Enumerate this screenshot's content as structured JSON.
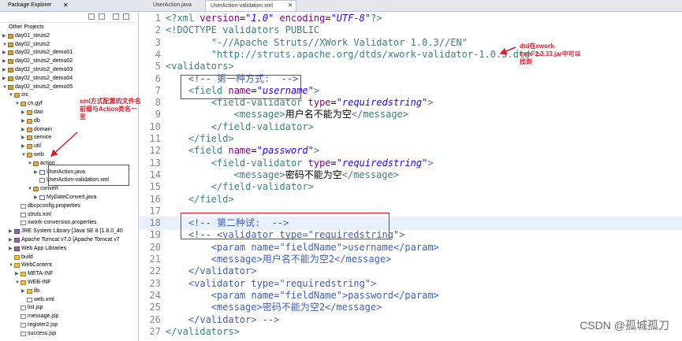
{
  "explorer": {
    "title": "Package Explorer",
    "close": "✕",
    "tree": [
      {
        "label": "Other Projects",
        "depth": 0,
        "icon": "none",
        "twisty": ""
      },
      {
        "label": "day01_struts2",
        "depth": 0,
        "icon": "proj",
        "twisty": "▶"
      },
      {
        "label": "day02_struts2",
        "depth": 0,
        "icon": "proj",
        "twisty": "▼"
      },
      {
        "label": "day02_struts2_demo01",
        "depth": 0,
        "icon": "proj",
        "twisty": "▶"
      },
      {
        "label": "day02_struts2_demo02",
        "depth": 0,
        "icon": "proj",
        "twisty": "▶"
      },
      {
        "label": "day02_struts2_demo03",
        "depth": 0,
        "icon": "proj",
        "twisty": "▶"
      },
      {
        "label": "day02_struts2_demo04",
        "depth": 0,
        "icon": "proj",
        "twisty": "▶"
      },
      {
        "label": "day02_struts2_demo05",
        "depth": 0,
        "icon": "proj",
        "twisty": "▼"
      },
      {
        "label": "src",
        "depth": 1,
        "icon": "pkg",
        "twisty": "▼"
      },
      {
        "label": "cn.gyf",
        "depth": 2,
        "icon": "pkg",
        "twisty": "▼"
      },
      {
        "label": "dao",
        "depth": 3,
        "icon": "pkg",
        "twisty": "▶"
      },
      {
        "label": "db",
        "depth": 3,
        "icon": "pkg",
        "twisty": "▶"
      },
      {
        "label": "domain",
        "depth": 3,
        "icon": "pkg",
        "twisty": "▶"
      },
      {
        "label": "service",
        "depth": 3,
        "icon": "pkg",
        "twisty": "▶"
      },
      {
        "label": "util",
        "depth": 3,
        "icon": "pkg",
        "twisty": "▶"
      },
      {
        "label": "web",
        "depth": 3,
        "icon": "pkg",
        "twisty": "▼"
      },
      {
        "label": "action",
        "depth": 4,
        "icon": "pkg",
        "twisty": "▼"
      },
      {
        "label": "UserAction.java",
        "depth": 5,
        "icon": "java",
        "twisty": "▶"
      },
      {
        "label": "UserAction-validation.xml",
        "depth": 5,
        "icon": "xml",
        "twisty": ""
      },
      {
        "label": "convert",
        "depth": 4,
        "icon": "pkg",
        "twisty": "▼"
      },
      {
        "label": "MyDateConvert.java",
        "depth": 5,
        "icon": "java",
        "twisty": "▶"
      },
      {
        "label": "dbcpconfig.properties",
        "depth": 2,
        "icon": "file",
        "twisty": ""
      },
      {
        "label": "struts.xml",
        "depth": 2,
        "icon": "xml",
        "twisty": ""
      },
      {
        "label": "xwork-conversion.properties",
        "depth": 2,
        "icon": "file",
        "twisty": ""
      },
      {
        "label": "JRE System Library [Java SE 8 [1.8.0_40",
        "depth": 1,
        "icon": "lib",
        "twisty": "▶"
      },
      {
        "label": "Apache Tomcat v7.0 [Apache Tomcat v7",
        "depth": 1,
        "icon": "lib",
        "twisty": "▶"
      },
      {
        "label": "Web App Libraries",
        "depth": 1,
        "icon": "lib",
        "twisty": "▶"
      },
      {
        "label": "build",
        "depth": 1,
        "icon": "fold",
        "twisty": ""
      },
      {
        "label": "WebContent",
        "depth": 1,
        "icon": "fold",
        "twisty": "▼"
      },
      {
        "label": "META-INF",
        "depth": 2,
        "icon": "fold",
        "twisty": "▶"
      },
      {
        "label": "WEB-INF",
        "depth": 2,
        "icon": "fold",
        "twisty": "▼"
      },
      {
        "label": "lib",
        "depth": 3,
        "icon": "fold",
        "twisty": "▶"
      },
      {
        "label": "web.xml",
        "depth": 3,
        "icon": "xml",
        "twisty": ""
      },
      {
        "label": "list.jsp",
        "depth": 2,
        "icon": "file",
        "twisty": ""
      },
      {
        "label": "message.jsp",
        "depth": 2,
        "icon": "file",
        "twisty": ""
      },
      {
        "label": "register2.jsp",
        "depth": 2,
        "icon": "file",
        "twisty": ""
      },
      {
        "label": "success.jsp",
        "depth": 2,
        "icon": "file",
        "twisty": ""
      }
    ]
  },
  "editor_tabs": [
    {
      "label": "UserAction.java",
      "active": false
    },
    {
      "label": "UserAction-validation.xml",
      "active": true
    },
    {
      "label": "✕",
      "active": false
    }
  ],
  "code_lines": [
    {
      "n": "1",
      "hl": false,
      "toks": [
        [
          "t-tag",
          "<?xml "
        ],
        [
          "t-attr",
          "version"
        ],
        [
          "t-plain",
          "="
        ],
        [
          "t-val",
          "\"1.0\""
        ],
        [
          "t-plain",
          " "
        ],
        [
          "t-attr",
          "encoding"
        ],
        [
          "t-plain",
          "="
        ],
        [
          "t-val",
          "\"UTF-8\""
        ],
        [
          "t-tag",
          "?>"
        ]
      ]
    },
    {
      "n": "2",
      "hl": false,
      "toks": [
        [
          "t-tag",
          "<!DOCTYPE validators PUBLIC"
        ]
      ]
    },
    {
      "n": "3",
      "hl": false,
      "toks": [
        [
          "t-plain",
          "        "
        ],
        [
          "t-tag",
          "\"-//Apache Struts//XWork Validator 1.0.3//EN\""
        ]
      ]
    },
    {
      "n": "4",
      "hl": false,
      "toks": [
        [
          "t-plain",
          "        "
        ],
        [
          "t-tag",
          "\"http://struts.apache.org/dtds/xwork-validator-1.0.3.dtd\">"
        ]
      ]
    },
    {
      "n": "5",
      "hl": false,
      "toks": [
        [
          "t-tag",
          "<validators>"
        ]
      ]
    },
    {
      "n": "6",
      "hl": false,
      "toks": [
        [
          "t-plain",
          "    "
        ],
        [
          "t-cmt",
          "<!-- 第一种方式:  -->"
        ]
      ]
    },
    {
      "n": "7",
      "hl": false,
      "toks": [
        [
          "t-plain",
          "    "
        ],
        [
          "t-tag",
          "<field "
        ],
        [
          "t-attr",
          "name"
        ],
        [
          "t-plain",
          "="
        ],
        [
          "t-val",
          "\"username\""
        ],
        [
          "t-tag",
          ">"
        ]
      ]
    },
    {
      "n": "8",
      "hl": false,
      "toks": [
        [
          "t-plain",
          "        "
        ],
        [
          "t-tag",
          "<field-validator "
        ],
        [
          "t-attr",
          "type"
        ],
        [
          "t-plain",
          "="
        ],
        [
          "t-val",
          "\"requiredstring\""
        ],
        [
          "t-tag",
          ">"
        ]
      ]
    },
    {
      "n": "9",
      "hl": false,
      "toks": [
        [
          "t-plain",
          "            "
        ],
        [
          "t-tag",
          "<message>"
        ],
        [
          "t-plain",
          "用户名不能为空"
        ],
        [
          "t-tag",
          "</message>"
        ]
      ]
    },
    {
      "n": "10",
      "hl": false,
      "toks": [
        [
          "t-plain",
          "        "
        ],
        [
          "t-tag",
          "</field-validator>"
        ]
      ]
    },
    {
      "n": "11",
      "hl": false,
      "toks": [
        [
          "t-plain",
          "    "
        ],
        [
          "t-tag",
          "</field>"
        ]
      ]
    },
    {
      "n": "12",
      "hl": false,
      "toks": [
        [
          "t-plain",
          "    "
        ],
        [
          "t-tag",
          "<field "
        ],
        [
          "t-attr",
          "name"
        ],
        [
          "t-plain",
          "="
        ],
        [
          "t-val",
          "\"password\""
        ],
        [
          "t-tag",
          ">"
        ]
      ]
    },
    {
      "n": "13",
      "hl": false,
      "toks": [
        [
          "t-plain",
          "        "
        ],
        [
          "t-tag",
          "<field-validator "
        ],
        [
          "t-attr",
          "type"
        ],
        [
          "t-plain",
          "="
        ],
        [
          "t-val",
          "\"requiredstring\""
        ],
        [
          "t-tag",
          ">"
        ]
      ]
    },
    {
      "n": "14",
      "hl": false,
      "toks": [
        [
          "t-plain",
          "            "
        ],
        [
          "t-tag",
          "<message>"
        ],
        [
          "t-plain",
          "密码不能为空"
        ],
        [
          "t-tag",
          "</message>"
        ]
      ]
    },
    {
      "n": "15",
      "hl": false,
      "toks": [
        [
          "t-plain",
          "        "
        ],
        [
          "t-tag",
          "</field-validator>"
        ]
      ]
    },
    {
      "n": "16",
      "hl": false,
      "toks": [
        [
          "t-plain",
          "    "
        ],
        [
          "t-tag",
          "</field>"
        ]
      ]
    },
    {
      "n": "17",
      "hl": false,
      "toks": [
        [
          "t-plain",
          ""
        ]
      ]
    },
    {
      "n": "18",
      "hl": true,
      "toks": [
        [
          "t-plain",
          "    "
        ],
        [
          "t-cmt",
          "<!-- 第二种试:  -->"
        ]
      ]
    },
    {
      "n": "19",
      "hl": false,
      "toks": [
        [
          "t-plain",
          "    "
        ],
        [
          "t-cmt",
          "<!-- <validator type=\"requiredstring\">"
        ]
      ]
    },
    {
      "n": "20",
      "hl": false,
      "toks": [
        [
          "t-plain",
          "        "
        ],
        [
          "t-cmt",
          "<param name=\"fieldName\">username</param>"
        ]
      ]
    },
    {
      "n": "21",
      "hl": false,
      "toks": [
        [
          "t-plain",
          "        "
        ],
        [
          "t-cmt",
          "<message>用户名不能为空2</message>"
        ]
      ]
    },
    {
      "n": "22",
      "hl": false,
      "toks": [
        [
          "t-plain",
          "    "
        ],
        [
          "t-cmt",
          "</validator>"
        ]
      ]
    },
    {
      "n": "23",
      "hl": false,
      "toks": [
        [
          "t-plain",
          "    "
        ],
        [
          "t-cmt",
          "<validator type=\"requiredstring\">"
        ]
      ]
    },
    {
      "n": "24",
      "hl": false,
      "toks": [
        [
          "t-plain",
          "        "
        ],
        [
          "t-cmt",
          "<param name=\"fieldName\">password</param>"
        ]
      ]
    },
    {
      "n": "25",
      "hl": false,
      "toks": [
        [
          "t-plain",
          "        "
        ],
        [
          "t-cmt",
          "<message>密码不能为空2</message>"
        ]
      ]
    },
    {
      "n": "26",
      "hl": false,
      "toks": [
        [
          "t-plain",
          "    "
        ],
        [
          "t-cmt",
          "</validator> -->"
        ]
      ]
    },
    {
      "n": "27",
      "hl": false,
      "toks": [
        [
          "t-tag",
          "</validators>"
        ]
      ]
    }
  ],
  "annotations": {
    "left_note_line1": "xml方式配置的文件名",
    "left_note_line2": "前缀与Action类名一",
    "left_note_line3": "至",
    "right_note_line1": "dtd在xwork-",
    "right_note_line2": "core-2.3.33.jar中可以",
    "right_note_line3": "找到"
  },
  "watermark": "CSDN @孤城孤刀",
  "colors": {
    "annotation": "#e0192a",
    "tag": "#3f7f7f",
    "attr": "#7f007f",
    "value": "#2a00ff",
    "comment": "#3f5fbf"
  }
}
